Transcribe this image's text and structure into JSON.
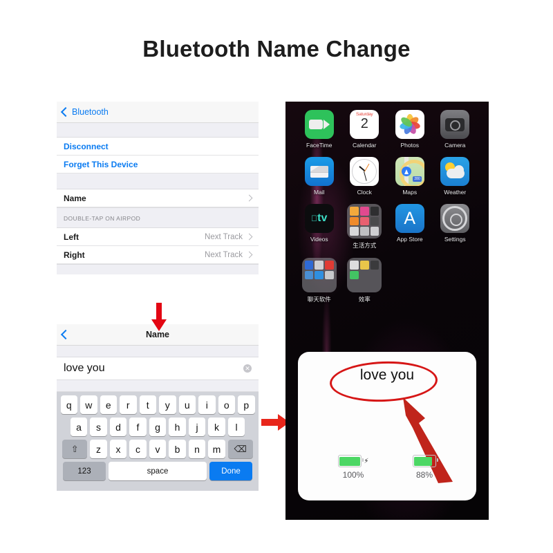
{
  "page": {
    "title": "Bluetooth Name Change"
  },
  "settings_panel": {
    "nav_back_label": "Bluetooth",
    "back_icon": "chevron-left-icon",
    "actions": [
      {
        "label": "Disconnect"
      },
      {
        "label": "Forget This Device"
      }
    ],
    "name_row": {
      "label": "Name",
      "disclosure_icon": "chevron-right-icon"
    },
    "section_header": "DOUBLE-TAP ON AIRPOD",
    "rows": [
      {
        "label": "Left",
        "value": "Next Track",
        "disclosure_icon": "chevron-right-icon"
      },
      {
        "label": "Right",
        "value": "Next Track",
        "disclosure_icon": "chevron-right-icon"
      }
    ]
  },
  "name_panel": {
    "nav_title": "Name",
    "back_icon": "chevron-left-icon",
    "text_field": {
      "value": "love you",
      "placeholder": "Name",
      "clear_icon": "clear-circle-icon"
    },
    "keyboard": {
      "row1": [
        "q",
        "w",
        "e",
        "r",
        "t",
        "y",
        "u",
        "i",
        "o",
        "p"
      ],
      "row2": [
        "a",
        "s",
        "d",
        "f",
        "g",
        "h",
        "j",
        "k",
        "l"
      ],
      "row3": [
        "z",
        "x",
        "c",
        "v",
        "b",
        "n",
        "m"
      ],
      "shift_icon": "shift-arrow-icon",
      "delete_icon": "backspace-icon",
      "numeric_label": "123",
      "space_label": "space",
      "done_label": "Done"
    }
  },
  "annotations": {
    "down_arrow_icon": "red-arrow-down-icon",
    "right_arrow_icon": "red-arrow-right-icon",
    "card_arrow_icon": "red-arrow-pointing-to-name-icon",
    "highlight_ellipse_icon": "red-ellipse-highlight-icon",
    "accent_color": "#d61616"
  },
  "phone": {
    "apps": [
      {
        "label": "FaceTime",
        "icon": "facetime-icon"
      },
      {
        "label": "Calendar",
        "icon": "calendar-icon",
        "weekday": "Saturday",
        "day": "2"
      },
      {
        "label": "Photos",
        "icon": "photos-icon"
      },
      {
        "label": "Camera",
        "icon": "camera-icon"
      },
      {
        "label": "Mail",
        "icon": "mail-icon"
      },
      {
        "label": "Clock",
        "icon": "clock-icon"
      },
      {
        "label": "Maps",
        "icon": "maps-icon",
        "badge": "280"
      },
      {
        "label": "Weather",
        "icon": "weather-icon"
      },
      {
        "label": "Videos",
        "icon": "apple-tv-icon",
        "glyph": "tv"
      },
      {
        "label": "生活方式",
        "icon": "folder-icon"
      },
      {
        "label": "App Store",
        "icon": "app-store-icon",
        "glyph": "A"
      },
      {
        "label": "Settings",
        "icon": "settings-gear-icon"
      },
      {
        "label": "聊天软件",
        "icon": "folder-icon"
      },
      {
        "label": "效率",
        "icon": "folder-icon"
      }
    ],
    "battery_card": {
      "device_name": "love you",
      "batteries": [
        {
          "percent_label": "100%",
          "level": 100,
          "charging": true,
          "bolt_icon": "lightning-bolt-icon"
        },
        {
          "percent_label": "88%",
          "level": 88,
          "charging": false
        }
      ]
    }
  }
}
